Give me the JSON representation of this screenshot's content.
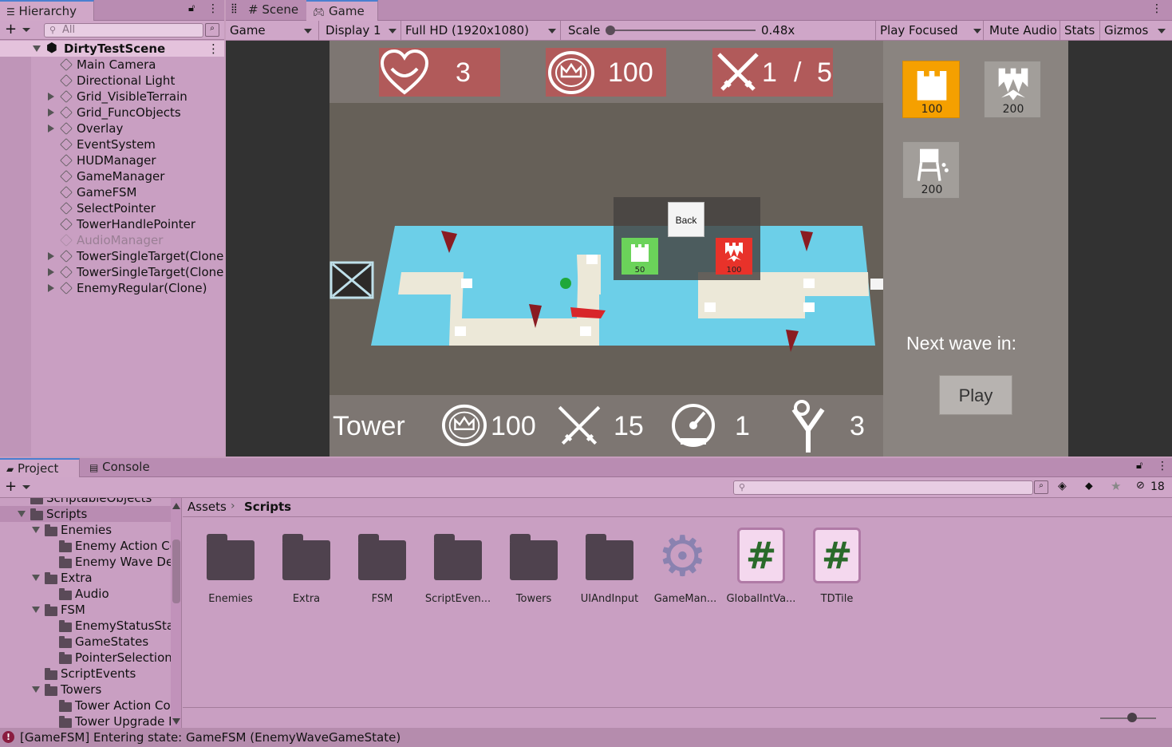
{
  "hierarchy": {
    "tab": "Hierarchy",
    "search_placeholder": "All",
    "scene": "DirtyTestScene",
    "items": [
      {
        "label": "Main Camera",
        "expandable": false,
        "dim": false
      },
      {
        "label": "Directional Light",
        "expandable": false,
        "dim": false
      },
      {
        "label": "Grid_VisibleTerrain",
        "expandable": true,
        "dim": false
      },
      {
        "label": "Grid_FuncObjects",
        "expandable": true,
        "dim": false
      },
      {
        "label": "Overlay",
        "expandable": true,
        "dim": false
      },
      {
        "label": "EventSystem",
        "expandable": false,
        "dim": false
      },
      {
        "label": "HUDManager",
        "expandable": false,
        "dim": false
      },
      {
        "label": "GameManager",
        "expandable": false,
        "dim": false
      },
      {
        "label": "GameFSM",
        "expandable": false,
        "dim": false
      },
      {
        "label": "SelectPointer",
        "expandable": false,
        "dim": false
      },
      {
        "label": "TowerHandlePointer",
        "expandable": false,
        "dim": false
      },
      {
        "label": "AudioManager",
        "expandable": false,
        "dim": true
      },
      {
        "label": "TowerSingleTarget(Clone)",
        "expandable": true,
        "dim": false
      },
      {
        "label": "TowerSingleTarget(Clone)",
        "expandable": true,
        "dim": false
      },
      {
        "label": "EnemyRegular(Clone)",
        "expandable": true,
        "dim": false
      }
    ]
  },
  "game_panel": {
    "tabs": [
      "Scene",
      "Game"
    ],
    "toolbar": {
      "view": "Game",
      "display": "Display 1",
      "resolution": "Full HD (1920x1080)",
      "scale_label": "Scale",
      "scale_value": "0.48x",
      "scale_fraction": 0.0,
      "play_focused": "Play Focused",
      "mute": "Mute Audio",
      "stats": "Stats",
      "gizmos": "Gizmos"
    }
  },
  "game": {
    "hud_top": {
      "lives": "3",
      "coins": "100",
      "wave": "1",
      "wave_sep": "/",
      "wave_total": "5"
    },
    "shop": [
      {
        "price": "100",
        "selected": true
      },
      {
        "price": "200",
        "selected": false
      },
      {
        "price": "200",
        "selected": false
      }
    ],
    "next_wave_label": "Next wave in:",
    "play_button": "Play",
    "popup": {
      "back_label": "Back",
      "option_a_price": "50",
      "option_b_price": "100"
    },
    "tower_bar": {
      "title": "Tower",
      "cost": "100",
      "damage": "15",
      "speed": "1",
      "range": "3"
    }
  },
  "project": {
    "tabs": [
      "Project",
      "Console"
    ],
    "tree": [
      {
        "label": "ScriptableObjects",
        "depth": 1,
        "arrow": "none",
        "partial": true
      },
      {
        "label": "Scripts",
        "depth": 1,
        "arrow": "down",
        "selected": true
      },
      {
        "label": "Enemies",
        "depth": 2,
        "arrow": "down"
      },
      {
        "label": "Enemy Action Co",
        "depth": 3,
        "arrow": "none"
      },
      {
        "label": "Enemy Wave De",
        "depth": 3,
        "arrow": "none"
      },
      {
        "label": "Extra",
        "depth": 2,
        "arrow": "down"
      },
      {
        "label": "Audio",
        "depth": 3,
        "arrow": "none"
      },
      {
        "label": "FSM",
        "depth": 2,
        "arrow": "down"
      },
      {
        "label": "EnemyStatusSta",
        "depth": 3,
        "arrow": "none"
      },
      {
        "label": "GameStates",
        "depth": 3,
        "arrow": "none"
      },
      {
        "label": "PointerSelection",
        "depth": 3,
        "arrow": "none"
      },
      {
        "label": "ScriptEvents",
        "depth": 2,
        "arrow": "none"
      },
      {
        "label": "Towers",
        "depth": 2,
        "arrow": "down"
      },
      {
        "label": "Tower Action Co",
        "depth": 3,
        "arrow": "none"
      },
      {
        "label": "Tower Upgrade I",
        "depth": 3,
        "arrow": "none"
      }
    ],
    "breadcrumb": [
      "Assets",
      "Scripts"
    ],
    "hidden_count": "18",
    "assets": [
      {
        "label": "Enemies",
        "kind": "folder"
      },
      {
        "label": "Extra",
        "kind": "folder"
      },
      {
        "label": "FSM",
        "kind": "folder"
      },
      {
        "label": "ScriptEven...",
        "kind": "folder"
      },
      {
        "label": "Towers",
        "kind": "folder"
      },
      {
        "label": "UIAndInput",
        "kind": "folder"
      },
      {
        "label": "GameMan...",
        "kind": "gear"
      },
      {
        "label": "GlobalIntVa...",
        "kind": "script"
      },
      {
        "label": "TDTile",
        "kind": "script"
      }
    ]
  },
  "status_bar": {
    "message": "[GameFSM] Entering state: GameFSM (EnemyWaveGameState)"
  },
  "colors": {
    "editor_bg": "#c99fc2",
    "hud_red": "#b15a5a",
    "water": "#6ccfe8",
    "path": "#ece8d8",
    "selected_tower": "#f5a000",
    "popup_green": "#6bd35a",
    "popup_red": "#e8322a"
  }
}
